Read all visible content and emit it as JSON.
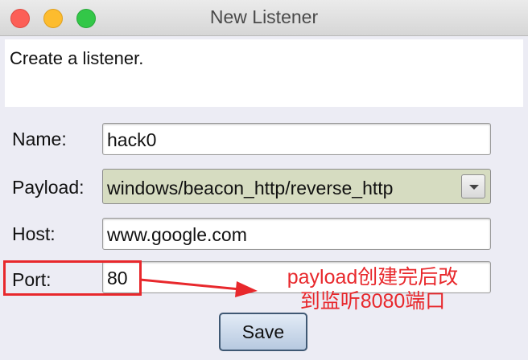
{
  "window": {
    "title": "New Listener"
  },
  "description": "Create a listener.",
  "form": {
    "name": {
      "label": "Name:",
      "value": "hack0"
    },
    "payload": {
      "label": "Payload:",
      "value": "windows/beacon_http/reverse_http"
    },
    "host": {
      "label": "Host:",
      "value": "www.google.com"
    },
    "port": {
      "label": "Port:",
      "value": "80"
    }
  },
  "save_button": {
    "label": "Save"
  },
  "annotation": {
    "line1": "payload创建完后改",
    "line2": "到监听8080端口",
    "color": "#e8282c"
  }
}
